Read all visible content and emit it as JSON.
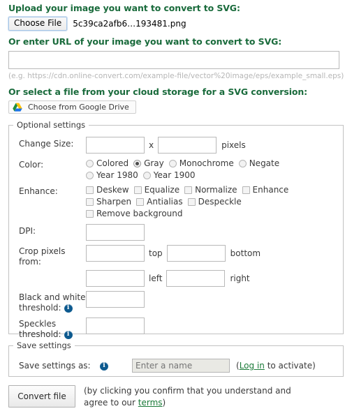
{
  "upload": {
    "heading": "Upload your image you want to convert to SVG:",
    "choose_file_label": "Choose File",
    "file_name": "5c39ca2afb6…193481.png"
  },
  "url": {
    "heading": "Or enter URL of your image you want to convert to SVG:",
    "value": "",
    "placeholder": "",
    "hint": "(e.g. https://cdn.online-convert.com/example-file/vector%20image/eps/example_small.eps)"
  },
  "cloud": {
    "heading": "Or select a file from your cloud storage for a SVG conversion:",
    "google_drive_label": "Choose from Google Drive",
    "google_drive_icon": "google-drive-icon"
  },
  "optional_settings": {
    "legend": "Optional settings",
    "change_size": {
      "label": "Change Size:",
      "width_value": "",
      "height_value": "",
      "separator": "x",
      "unit": "pixels"
    },
    "color": {
      "label": "Color:",
      "options": [
        {
          "label": "Colored",
          "selected": false
        },
        {
          "label": "Gray",
          "selected": true
        },
        {
          "label": "Monochrome",
          "selected": false
        },
        {
          "label": "Negate",
          "selected": false
        },
        {
          "label": "Year 1980",
          "selected": false
        },
        {
          "label": "Year 1900",
          "selected": false
        }
      ]
    },
    "enhance": {
      "label": "Enhance:",
      "options": [
        {
          "label": "Deskew",
          "checked": false
        },
        {
          "label": "Equalize",
          "checked": false
        },
        {
          "label": "Normalize",
          "checked": false
        },
        {
          "label": "Enhance",
          "checked": false
        },
        {
          "label": "Sharpen",
          "checked": false
        },
        {
          "label": "Antialias",
          "checked": false
        },
        {
          "label": "Despeckle",
          "checked": false
        },
        {
          "label": "Remove background",
          "checked": false
        }
      ]
    },
    "dpi": {
      "label": "DPI:",
      "value": ""
    },
    "crop": {
      "label_line1": "Crop pixels",
      "label_line2": "from:",
      "top_value": "",
      "top_unit": "top",
      "bottom_value": "",
      "bottom_unit": "bottom",
      "left_value": "",
      "left_unit": "left",
      "right_value": "",
      "right_unit": "right"
    },
    "bw_threshold": {
      "label_line1": "Black and white",
      "label_line2": "threshold:",
      "value": "",
      "info_icon": "info-icon"
    },
    "speckles_threshold": {
      "label_line1": "Speckles",
      "label_line2": "threshold:",
      "value": "",
      "info_icon": "info-icon"
    }
  },
  "save_settings": {
    "legend": "Save settings",
    "label": "Save settings as:",
    "info_icon": "info-icon",
    "input_value": "",
    "input_placeholder": "Enter a name",
    "note_prefix": "(",
    "note_link": "Log in",
    "note_suffix": " to activate)"
  },
  "footer": {
    "convert_label": "Convert file",
    "terms_line1": "(by clicking you confirm that you understand and",
    "terms_line2_prefix": "agree to our ",
    "terms_link": "terms",
    "terms_line2_suffix": ")"
  },
  "colors": {
    "heading_green": "#1a6b3c",
    "link_green": "#1a7a38",
    "info_blue": "#0d5a8f",
    "border_gray": "#c2c2c2"
  }
}
